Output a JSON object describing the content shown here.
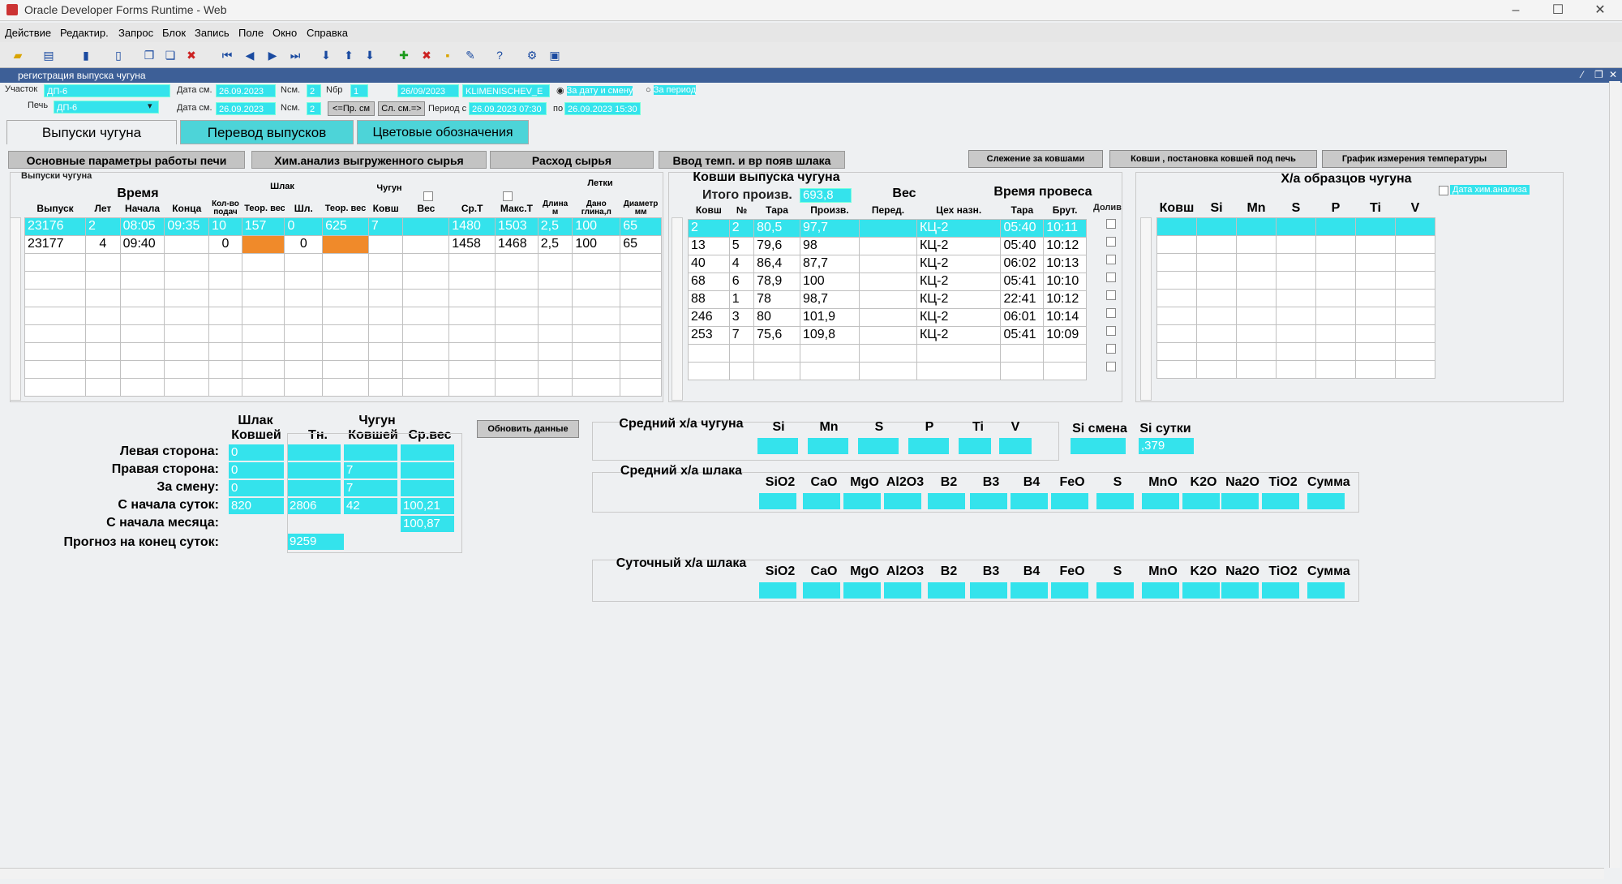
{
  "window": {
    "title": "Oracle Developer Forms Runtime - Web",
    "min": "–",
    "max": "☐",
    "close": "✕"
  },
  "menu": [
    "Действие",
    "Редактир.",
    "Запрос",
    "Блок",
    "Запись",
    "Поле",
    "Окно",
    "Справка"
  ],
  "form_title": "регистрация выпуска чугуна",
  "header": {
    "uchastok_label": "Участок",
    "uchastok_value": "ДП-6",
    "pech_label": "Печь",
    "pech_value": "ДП-6",
    "data_sm_label": "Дата см.",
    "data_sm_value": "26.09.2023",
    "nsm_label": "Nсм.",
    "nsm_value": "2",
    "nbr_label": "Nбр",
    "nbr_value": "1",
    "date2": "26/09/2023",
    "user": "KLIMENISCHEV_E",
    "radio1": "За дату и смену",
    "radio2": "За период",
    "data_sm2_value": "26.09.2023",
    "nsm2_value": "2",
    "btn_prev": "<=Пр. см",
    "btn_next": "Сл. см.=>",
    "period_label": "Период с",
    "period_from": "26.09.2023 07:30",
    "po_label": "по",
    "period_to": "26.09.2023 15:30"
  },
  "tabs": [
    "Выпуски чугуна",
    "Перевод выпусков",
    "Цветовые обозначения"
  ],
  "subtabs": [
    "Основные параметры работы печи",
    "Хим.анализ выгруженного сырья",
    "Расход сырья",
    "Ввод темп. и вр появ шлака"
  ],
  "right_buttons": [
    "Слежение за ковшами",
    "Ковши , постановка ковшей под печь",
    "График измерения температуры"
  ],
  "vypuski": {
    "title": "Выпуски чугуна",
    "group_vremya": "Время",
    "group_shlak": "Шлак",
    "group_chugun": "Чугун",
    "group_letki": "Летки",
    "cols": [
      "Выпуск",
      "Лет",
      "Начала",
      "Конца",
      "Кол-во подач",
      "Теор. вес",
      "Шл.",
      "Теор. вес",
      "Ковш",
      "Вес",
      "Ср.Т",
      "Макс.Т",
      "Длина м",
      "Дано глина,л",
      "Диаметр мм"
    ],
    "rows": [
      [
        "23176",
        "2",
        "08:05",
        "09:35",
        "10",
        "157",
        "0",
        "625",
        "7",
        "",
        "1480",
        "1503",
        "2,5",
        "100",
        "65"
      ],
      [
        "23177",
        "4",
        "09:40",
        "",
        "0",
        "",
        "0",
        "",
        "",
        "",
        "1458",
        "1468",
        "2,5",
        "100",
        "65"
      ]
    ]
  },
  "kovshi": {
    "title": "Ковши выпуска чугуна",
    "itogo_label": "Итого произв.",
    "itogo_value": "693,8",
    "group_ves": "Вес",
    "group_vremya": "Время провеса",
    "cols": [
      "Ковш",
      "№",
      "Тара",
      "Произв.",
      "Перед.",
      "Цех назн.",
      "Тара",
      "Брут.",
      "Долив"
    ],
    "rows": [
      [
        "2",
        "2",
        "80,5",
        "97,7",
        "",
        "КЦ-2",
        "05:40",
        "10:11"
      ],
      [
        "13",
        "5",
        "79,6",
        "98",
        "",
        "КЦ-2",
        "05:40",
        "10:12"
      ],
      [
        "40",
        "4",
        "86,4",
        "87,7",
        "",
        "КЦ-2",
        "06:02",
        "10:13"
      ],
      [
        "68",
        "6",
        "78,9",
        "100",
        "",
        "КЦ-2",
        "05:41",
        "10:10"
      ],
      [
        "88",
        "1",
        "78",
        "98,7",
        "",
        "КЦ-2",
        "22:41",
        "10:12"
      ],
      [
        "246",
        "3",
        "80",
        "101,9",
        "",
        "КЦ-2",
        "06:01",
        "10:14"
      ],
      [
        "253",
        "7",
        "75,6",
        "109,8",
        "",
        "КЦ-2",
        "05:41",
        "10:09"
      ]
    ]
  },
  "obrazcy": {
    "title": "Х/а образцов чугуна",
    "date_chk": "Дата хим.анализа",
    "cols": [
      "Ковш",
      "Si",
      "Mn",
      "S",
      "P",
      "Ti",
      "V"
    ]
  },
  "summary": {
    "h_shlak": "Шлак",
    "h_chugun": "Чугун",
    "cols": [
      "Ковшей",
      "Тн.",
      "Ковшей",
      "Ср.вес"
    ],
    "rows": [
      {
        "label": "Левая сторона:",
        "v": [
          "0",
          "",
          "",
          ""
        ]
      },
      {
        "label": "Правая  сторона:",
        "v": [
          "0",
          "",
          "7",
          ""
        ]
      },
      {
        "label": "За смену:",
        "v": [
          "0",
          "",
          "7",
          ""
        ]
      },
      {
        "label": "С начала суток:",
        "v": [
          "820",
          "2806",
          "42",
          "100,21"
        ]
      },
      {
        "label": "С начала месяца:",
        "v": [
          "",
          "",
          "",
          "100,87"
        ]
      }
    ],
    "prognoz_label": "Прогноз на конец суток:",
    "prognoz_value": "9259",
    "refresh": "Обновить данные"
  },
  "chem": {
    "chugun_title": "Средний х/а чугуна",
    "chugun_cols": [
      "Si",
      "Mn",
      "S",
      "P",
      "Ti",
      "V"
    ],
    "si_smena": "Si смена",
    "si_sutki": "Si сутки",
    "si_sutki_value": ",379",
    "shlak_title": "Средний х/а шлака",
    "sut_title": "Суточный х/а шлака",
    "shlak_cols": [
      "SiO2",
      "CaO",
      "MgO",
      "Al2O3",
      "B2",
      "B3",
      "B4",
      "FeO",
      "S",
      "MnO",
      "K2O",
      "Na2O",
      "TiO2",
      "Сумма"
    ]
  },
  "colors": {
    "field": "#34e3ec",
    "highlight": "#f08a2a",
    "header_bar": "#3d5f97"
  }
}
